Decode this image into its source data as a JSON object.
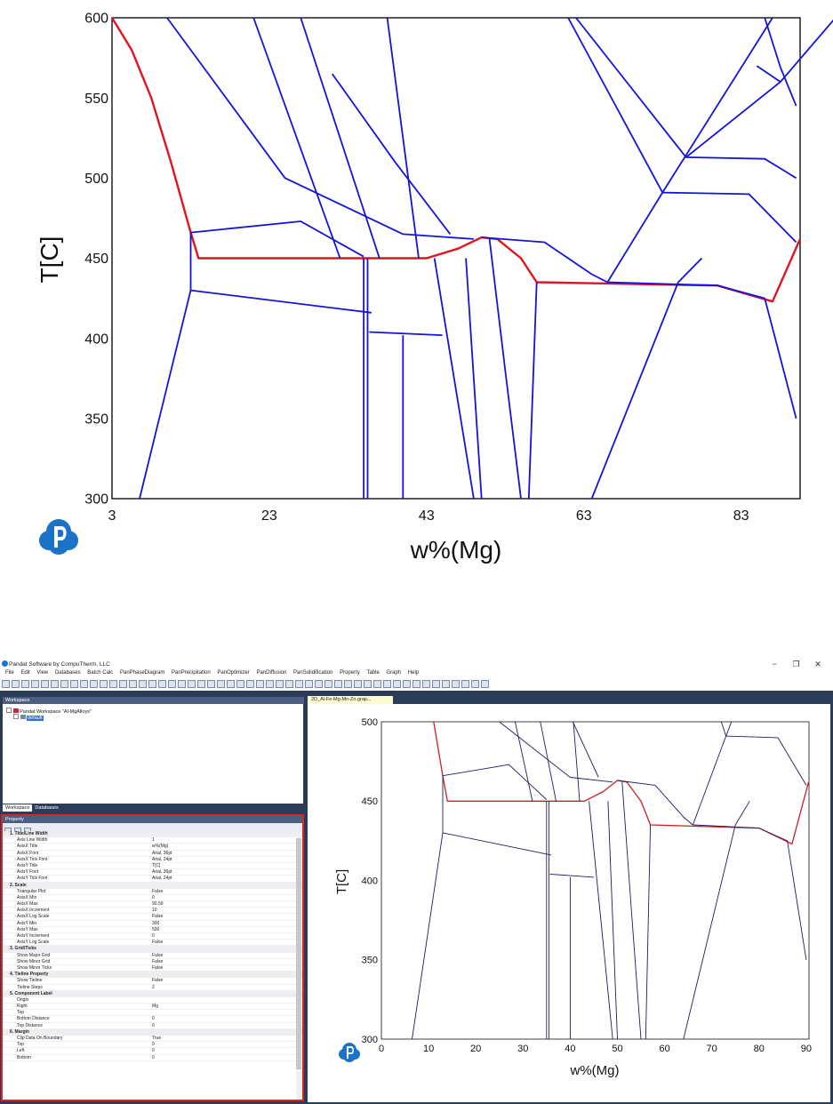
{
  "top_chart": {
    "xlabel": "w%(Mg)",
    "ylabel": "T[C]",
    "x_ticks": [
      "3",
      "23",
      "43",
      "63",
      "83"
    ],
    "y_ticks": [
      "300",
      "350",
      "400",
      "450",
      "500",
      "550",
      "600"
    ]
  },
  "chart_data": [
    {
      "type": "line",
      "xlabel": "w%(Mg)",
      "ylabel": "T[C]",
      "xlim": [
        3,
        90.5
      ],
      "ylim": [
        300,
        600
      ],
      "grid": false,
      "x_tick_labels": [
        "3",
        "23",
        "43",
        "63",
        "83"
      ],
      "y_tick_labels": [
        "300",
        "350",
        "400",
        "450",
        "500",
        "550",
        "600"
      ],
      "colors": {
        "phase_boundary": "#1414d8",
        "highlight": "#e0141e"
      },
      "series": [
        {
          "values": [
            [
              3,
              600
            ],
            [
              5.5,
              580
            ],
            [
              8,
              550
            ],
            [
              10.5,
              510
            ],
            [
              13,
              466
            ],
            [
              14,
              450
            ],
            [
              30,
              450
            ],
            [
              35,
              450
            ],
            [
              43,
              450
            ],
            [
              47,
              456
            ],
            [
              50,
              463
            ],
            [
              52,
              462
            ],
            [
              55,
              450
            ],
            [
              57,
              435
            ],
            [
              80,
              433
            ],
            [
              87,
              423
            ],
            [
              90.5,
              462
            ]
          ]
        },
        {
          "values": [
            [
              13,
              466
            ],
            [
              27,
              473
            ],
            [
              35,
              451
            ]
          ]
        },
        {
          "values": [
            [
              13,
              466
            ],
            [
              13,
              430
            ],
            [
              36,
              416
            ]
          ]
        },
        {
          "values": [
            [
              13,
              430
            ],
            [
              9,
              350
            ],
            [
              6.5,
              300
            ]
          ]
        },
        {
          "values": [
            [
              10,
              600
            ],
            [
              25,
              500
            ],
            [
              40,
              465
            ],
            [
              49,
              462
            ]
          ]
        },
        {
          "values": [
            [
              21,
              600
            ],
            [
              32,
              450
            ]
          ]
        },
        {
          "values": [
            [
              27,
              600
            ],
            [
              37,
              450
            ]
          ]
        },
        {
          "values": [
            [
              31,
              565
            ],
            [
              39,
              510
            ],
            [
              46,
              465
            ]
          ]
        },
        {
          "values": [
            [
              38,
              600
            ],
            [
              42,
              450
            ]
          ]
        },
        {
          "values": [
            [
              50,
              463
            ],
            [
              58,
              460
            ],
            [
              64,
              440
            ],
            [
              66,
              435
            ]
          ]
        },
        {
          "values": [
            [
              35,
              450
            ],
            [
              35,
              300
            ]
          ]
        },
        {
          "values": [
            [
              35.5,
              450
            ],
            [
              35.5,
              300
            ]
          ]
        },
        {
          "values": [
            [
              35.7,
              404
            ],
            [
              45,
              402
            ]
          ]
        },
        {
          "values": [
            [
              40,
              402
            ],
            [
              40,
              300
            ]
          ]
        },
        {
          "values": [
            [
              44,
              450
            ],
            [
              49,
              300
            ]
          ]
        },
        {
          "values": [
            [
              48,
              450
            ],
            [
              50,
              300
            ]
          ]
        },
        {
          "values": [
            [
              51,
              462
            ],
            [
              53,
              380
            ],
            [
              55,
              300
            ]
          ]
        },
        {
          "values": [
            [
              57,
              435
            ],
            [
              56,
              300
            ]
          ]
        },
        {
          "values": [
            [
              64,
              300
            ],
            [
              75,
              435
            ],
            [
              78,
              450
            ]
          ]
        },
        {
          "values": [
            [
              66,
              435
            ],
            [
              73,
              491
            ],
            [
              87,
              600
            ]
          ]
        },
        {
          "values": [
            [
              61,
              600
            ],
            [
              73,
              491
            ]
          ]
        },
        {
          "values": [
            [
              62,
              600
            ],
            [
              76,
              513
            ],
            [
              88,
              560
            ],
            [
              95,
              600
            ]
          ]
        },
        {
          "values": [
            [
              73,
              491
            ],
            [
              84,
              490
            ],
            [
              90,
              460
            ]
          ]
        },
        {
          "values": [
            [
              76,
              513
            ],
            [
              86,
              512
            ],
            [
              90,
              500
            ]
          ]
        },
        {
          "values": [
            [
              85,
              570
            ],
            [
              88,
              560
            ]
          ]
        },
        {
          "values": [
            [
              86,
              600
            ],
            [
              88,
              569
            ]
          ]
        },
        {
          "values": [
            [
              88,
              569
            ],
            [
              90,
              545
            ]
          ]
        },
        {
          "values": [
            [
              66,
              435
            ],
            [
              80,
              433
            ],
            [
              86,
              425
            ],
            [
              90,
              350
            ]
          ]
        }
      ]
    },
    {
      "type": "line",
      "xlabel": "w%(Mg)",
      "ylabel": "T[C]",
      "xlim": [
        0,
        90.59
      ],
      "ylim": [
        300,
        500
      ],
      "grid": false,
      "x_tick_labels": [
        "0",
        "10",
        "20",
        "30",
        "40",
        "50",
        "60",
        "70",
        "80",
        "90"
      ],
      "y_tick_labels": [
        "300",
        "350",
        "400",
        "450",
        "500"
      ],
      "colors": {
        "phase_boundary": "#1c1c66",
        "highlight": "#cc1e26"
      }
    }
  ],
  "app": {
    "title": "Pandat Software by CompuTherm, LLC",
    "menu": [
      "File",
      "Edit",
      "View",
      "Databases",
      "Batch Calc",
      "PanPhaseDiagram",
      "PanPrecipitation",
      "PanOptimizer",
      "PanDiffusion",
      "PanSolidification",
      "Property",
      "Table",
      "Graph",
      "Help"
    ],
    "workspace": {
      "header": "Workspace",
      "tree_root": "Pandat Workspace \"Al-MgAlloys\"",
      "tree_child": "default",
      "tabs": [
        "Workspace",
        "Databases"
      ]
    },
    "property": {
      "header": "Property",
      "rows": [
        {
          "cat": true,
          "k": "1. Title/Line Width",
          "v": ""
        },
        {
          "cat": false,
          "k": "Axis Line Width",
          "v": "1"
        },
        {
          "cat": false,
          "k": "AxisX Title",
          "v": "w%(Mg)"
        },
        {
          "cat": false,
          "k": "AxisX Font",
          "v": "Arial, 36pt"
        },
        {
          "cat": false,
          "k": "AxisX Tick Font",
          "v": "Arial, 24pt"
        },
        {
          "cat": false,
          "k": "AxisY Title",
          "v": "T[C]"
        },
        {
          "cat": false,
          "k": "AxisY Font",
          "v": "Arial, 36pt"
        },
        {
          "cat": false,
          "k": "AxisY Tick Font",
          "v": "Arial, 24pt"
        },
        {
          "cat": true,
          "k": "2. Scale",
          "v": ""
        },
        {
          "cat": false,
          "k": "Triangular Plot",
          "v": "False"
        },
        {
          "cat": false,
          "k": "AxisX Min",
          "v": "0"
        },
        {
          "cat": false,
          "k": "AxisX Max",
          "v": "90.59"
        },
        {
          "cat": false,
          "k": "AxisX Increment",
          "v": "10"
        },
        {
          "cat": false,
          "k": "AxisX Log Scale",
          "v": "False"
        },
        {
          "cat": false,
          "k": "AxisY Min",
          "v": "300"
        },
        {
          "cat": false,
          "k": "AxisY Max",
          "v": "500"
        },
        {
          "cat": false,
          "k": "AxisY Increment",
          "v": "0"
        },
        {
          "cat": false,
          "k": "AxisY Log Scale",
          "v": "False"
        },
        {
          "cat": true,
          "k": "3. Grid/Ticks",
          "v": ""
        },
        {
          "cat": false,
          "k": "Show Major Grid",
          "v": "False"
        },
        {
          "cat": false,
          "k": "Show Minor Grid",
          "v": "False"
        },
        {
          "cat": false,
          "k": "Show Minor Ticks",
          "v": "False"
        },
        {
          "cat": true,
          "k": "4. Tieline Property",
          "v": ""
        },
        {
          "cat": false,
          "k": "Show Tieline",
          "v": "False"
        },
        {
          "cat": false,
          "k": "Tieline Steps",
          "v": "2"
        },
        {
          "cat": true,
          "k": "5. Component Label",
          "v": ""
        },
        {
          "cat": false,
          "k": "Origin",
          "v": ""
        },
        {
          "cat": false,
          "k": "Right",
          "v": "Mg"
        },
        {
          "cat": false,
          "k": "Top",
          "v": ""
        },
        {
          "cat": false,
          "k": "Bottom Distance",
          "v": "0"
        },
        {
          "cat": false,
          "k": "Top Distance",
          "v": "0"
        },
        {
          "cat": true,
          "k": "6. Margin",
          "v": ""
        },
        {
          "cat": false,
          "k": "Clip Data On Boundary",
          "v": "True"
        },
        {
          "cat": false,
          "k": "Top",
          "v": "0"
        },
        {
          "cat": false,
          "k": "Left",
          "v": "0"
        },
        {
          "cat": false,
          "k": "Bottom",
          "v": "0"
        }
      ]
    },
    "doc_tab": "2D_Al-Fe-Mg-Mn-Zn.grap...",
    "inner_chart": {
      "xlabel": "w%(Mg)",
      "ylabel": "T[C]"
    }
  }
}
